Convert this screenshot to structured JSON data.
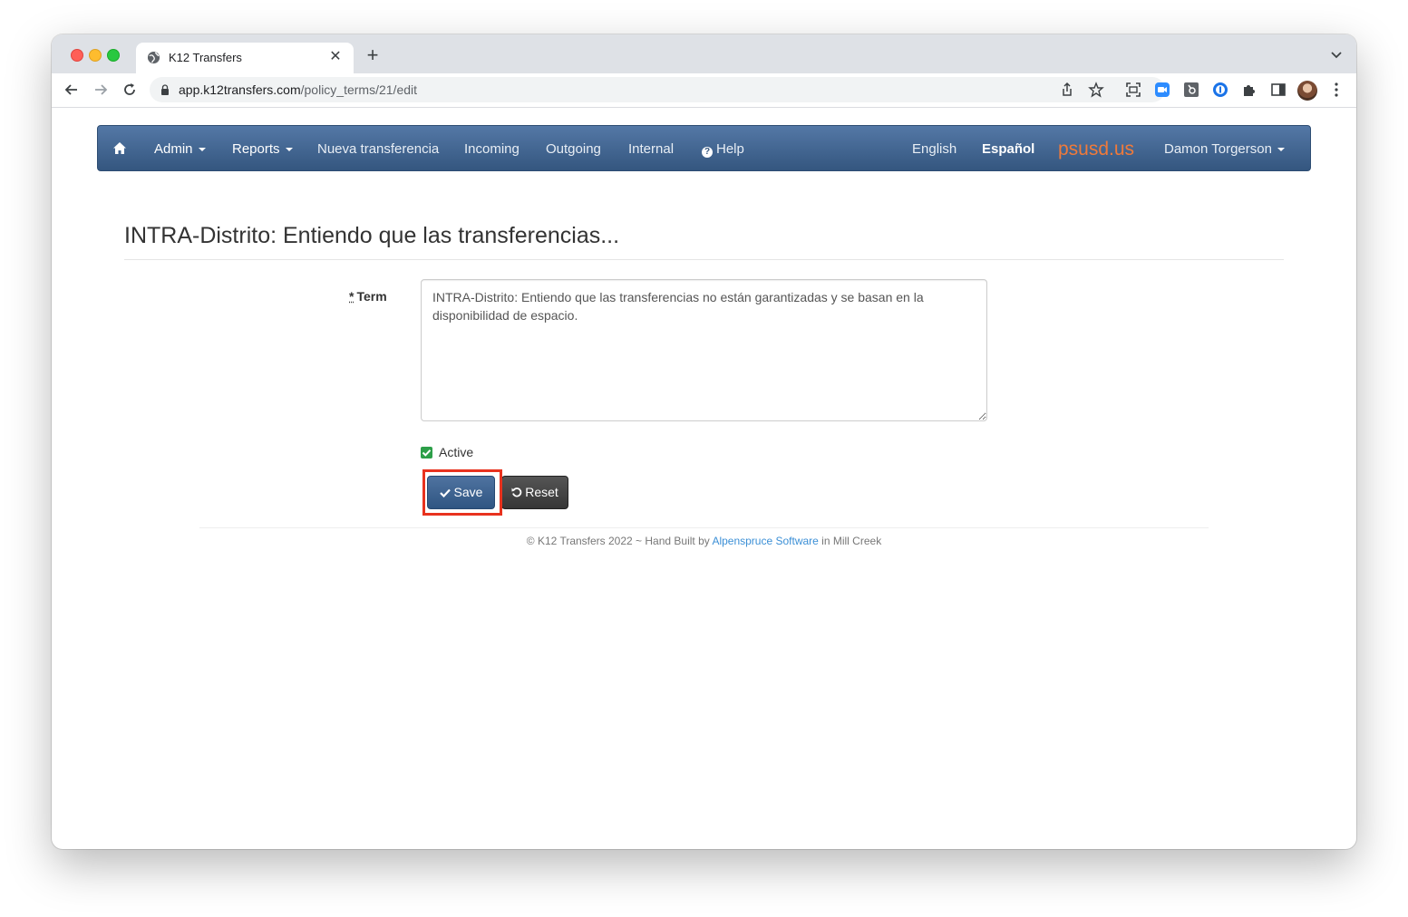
{
  "browser": {
    "tab_title": "K12 Transfers",
    "url_domain": "app.k12transfers.com",
    "url_path": "/policy_terms/21/edit"
  },
  "navbar": {
    "items_left": [
      "Admin",
      "Reports",
      "Nueva transferencia",
      "Incoming",
      "Outgoing",
      "Internal"
    ],
    "help": "Help",
    "lang_english": "English",
    "lang_spanish": "Español",
    "brand": "psusd.us",
    "user": "Damon Torgerson"
  },
  "page": {
    "title": "INTRA-Distrito: Entiendo que las transferencias...",
    "term_required_marker": "*",
    "term_label": "Term",
    "term_value": "INTRA-Distrito: Entiendo que las transferencias no están garantizadas y se basan en la disponibilidad de espacio.",
    "active_label": "Active",
    "active_checked": true,
    "save_label": "Save",
    "reset_label": "Reset"
  },
  "footer": {
    "prefix": "© K12 Transfers 2022 ~ Hand Built by ",
    "link": "Alpenspruce Software",
    "suffix": " in Mill Creek"
  },
  "colors": {
    "navbar": "#3e6290",
    "brand": "#f07a3a",
    "highlight": "#e8321e",
    "checkbox": "#2d9f49",
    "link": "#3b8fd6"
  }
}
